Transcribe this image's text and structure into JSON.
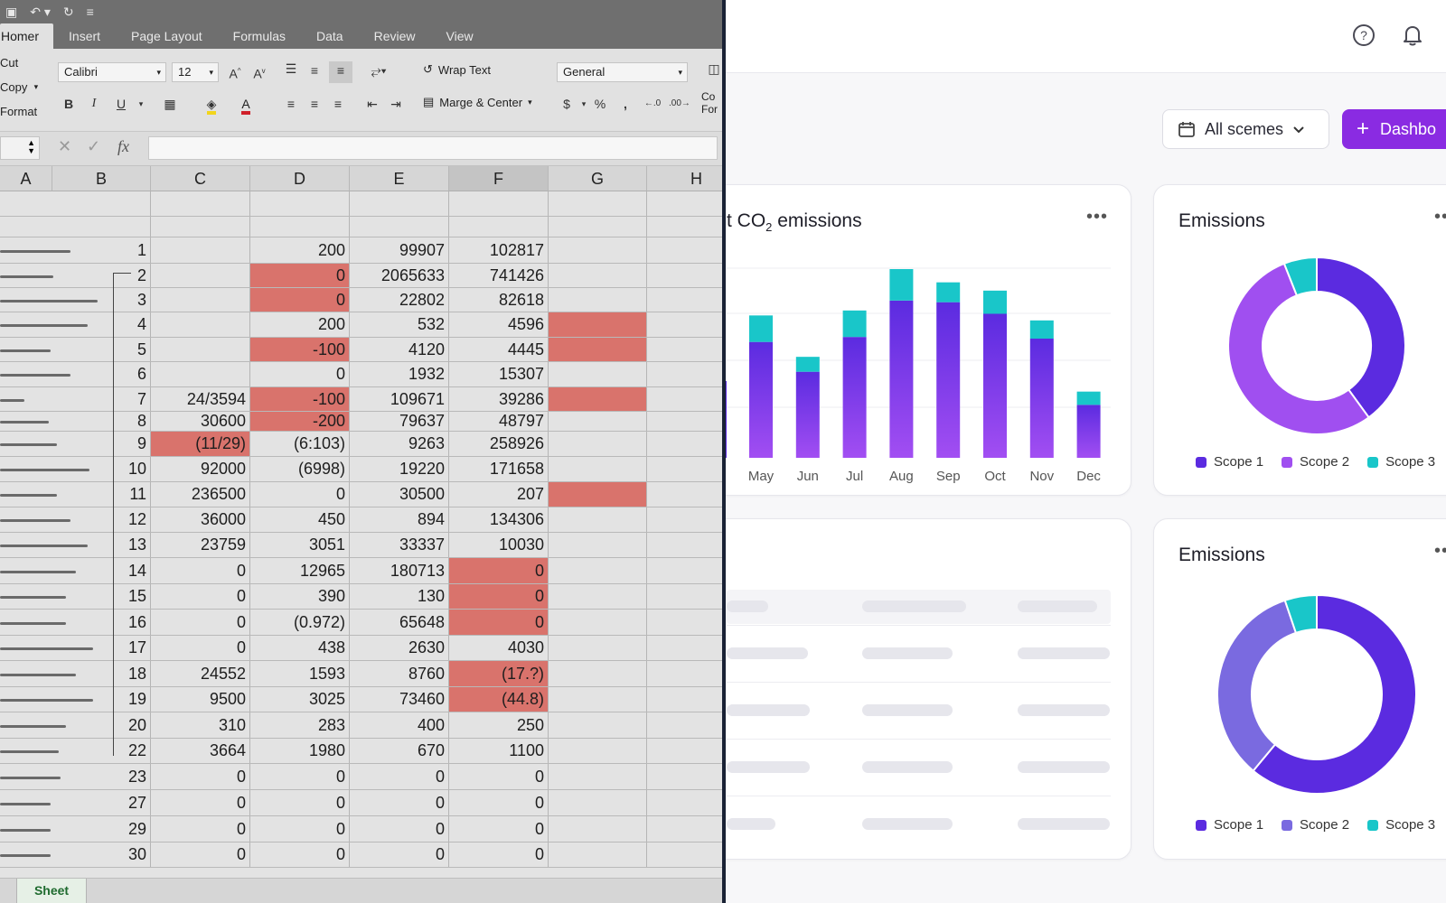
{
  "spreadsheet": {
    "tabs": [
      "Homer",
      "Insert",
      "Page Layout",
      "Formulas",
      "Data",
      "Review",
      "View"
    ],
    "clipboard": [
      "Cut",
      "Copy",
      "Format"
    ],
    "font_name": "Calibri",
    "font_size": "12",
    "wrap_text": "Wrap Text",
    "merge_center": "Marge & Center",
    "number_format": "General",
    "cond_format_fragment": [
      "Co",
      "For"
    ],
    "fx_label": "fx",
    "columns": [
      "A",
      "B",
      "C",
      "D",
      "E",
      "F",
      "G",
      "H"
    ],
    "rows": [
      {
        "b": "1",
        "c": "",
        "d": "200",
        "e": "99907",
        "f": "102817",
        "red": []
      },
      {
        "b": "2",
        "c": "",
        "d": "0",
        "e": "2065633",
        "f": "741426",
        "red": [
          "d"
        ]
      },
      {
        "b": "3",
        "c": "",
        "d": "0",
        "e": "22802",
        "f": "82618",
        "red": [
          "d"
        ]
      },
      {
        "b": "4",
        "c": "",
        "d": "200",
        "e": "532",
        "f": "4596",
        "red": [
          "g"
        ]
      },
      {
        "b": "5",
        "c": "",
        "d": "-100",
        "e": "4120",
        "f": "4445",
        "red": [
          "d",
          "g"
        ]
      },
      {
        "b": "6",
        "c": "",
        "d": "0",
        "e": "1932",
        "f": "15307",
        "red": []
      },
      {
        "b": "7",
        "c": "24/3594",
        "d": "-100",
        "e": "109671",
        "f": "39286",
        "red": [
          "d",
          "g"
        ]
      },
      {
        "b": "8",
        "c": "30600",
        "d": "-200",
        "e": "79637",
        "f": "48797",
        "red": [
          "d"
        ]
      },
      {
        "b": "9",
        "c": "(11/29)",
        "d": "(6:103)",
        "e": "9263",
        "f": "258926",
        "red": [
          "c"
        ]
      },
      {
        "b": "10",
        "c": "92000",
        "d": "(6998)",
        "e": "19220",
        "f": "171658",
        "red": []
      },
      {
        "b": "11",
        "c": "236500",
        "d": "0",
        "e": "30500",
        "f": "207",
        "red": [
          "g"
        ]
      },
      {
        "b": "12",
        "c": "36000",
        "d": "450",
        "e": "894",
        "f": "134306",
        "red": []
      },
      {
        "b": "13",
        "c": "23759",
        "d": "3051",
        "e": "33337",
        "f": "10030",
        "red": []
      },
      {
        "b": "14",
        "c": "0",
        "d": "12965",
        "e": "180713",
        "f": "0",
        "red": [
          "f"
        ]
      },
      {
        "b": "15",
        "c": "0",
        "d": "390",
        "e": "130",
        "f": "0",
        "red": [
          "f"
        ]
      },
      {
        "b": "16",
        "c": "0",
        "d": "(0.972)",
        "e": "65648",
        "f": "0",
        "red": [
          "f"
        ]
      },
      {
        "b": "17",
        "c": "0",
        "d": "438",
        "e": "2630",
        "f": "4030",
        "red": []
      },
      {
        "b": "18",
        "c": "24552",
        "d": "1593",
        "e": "8760",
        "f": "(17.?)",
        "red": [
          "f"
        ]
      },
      {
        "b": "19",
        "c": "9500",
        "d": "3025",
        "e": "73460",
        "f": "(44.8)",
        "red": [
          "f"
        ]
      },
      {
        "b": "20",
        "c": "310",
        "d": "283",
        "e": "400",
        "f": "250",
        "red": []
      },
      {
        "b": "22",
        "c": "3664",
        "d": "1980",
        "e": "670",
        "f": "1100",
        "red": []
      },
      {
        "b": "23",
        "c": "0",
        "d": "0",
        "e": "0",
        "f": "0",
        "red": []
      },
      {
        "b": "27",
        "c": "0",
        "d": "0",
        "e": "0",
        "f": "0",
        "red": []
      },
      {
        "b": "29",
        "c": "0",
        "d": "0",
        "e": "0",
        "f": "0",
        "red": []
      },
      {
        "b": "30",
        "c": "0",
        "d": "0",
        "e": "0",
        "f": "0",
        "red": []
      }
    ],
    "col_a_bars": [
      0.72,
      0.55,
      1.0,
      0.9,
      0.52,
      0.72,
      0.25,
      0.5,
      0.58,
      0.92,
      0.58,
      0.72,
      0.9,
      0.78,
      0.68,
      0.68,
      0.95,
      0.78,
      0.95,
      0.68,
      0.6,
      0.62,
      0.52,
      0.52,
      0.52
    ],
    "sheet_tab": "Sheet",
    "red_color": "#d9736c"
  },
  "dashboard": {
    "icons": [
      "help-circle-icon",
      "bell-icon",
      "calendar-icon",
      "chevron-down-icon",
      "plus-icon"
    ],
    "scene_filter": "All scemes",
    "dashboard_button": "Dashbo",
    "accent": "#8a2be2",
    "bar_card_title": "t CO",
    "bar_card_title_sub": "2",
    "bar_card_title_rest": " emissions",
    "pie_card_title": "Emissions",
    "pie2_card_title": "Emissions",
    "legend": [
      "Scope 1",
      "Scope 2",
      "Scope 3"
    ],
    "colors": {
      "scope1": "#5b2be0",
      "scope2": "#a04ff0",
      "scope2_alt": "#7a6ae0",
      "scope3": "#19c6c9"
    }
  },
  "chart_data": [
    {
      "type": "bar",
      "title": "t CO2 emissions",
      "categories": [
        "May",
        "Jun",
        "Jul",
        "Aug",
        "Sep",
        "Oct",
        "Nov",
        "Dec"
      ],
      "series": [
        {
          "values": [
            70,
            52,
            73,
            95,
            94,
            87,
            72,
            32
          ]
        },
        {
          "values": [
            16,
            9,
            16,
            19,
            12,
            14,
            11,
            8
          ]
        }
      ]
    },
    {
      "type": "pie",
      "title": "Emissions",
      "labels": [
        "Scope 1",
        "Scope 2",
        "Scope 3"
      ],
      "values": [
        40,
        54,
        6
      ]
    },
    {
      "type": "pie",
      "title": "Emissions",
      "labels": [
        "Scope 1",
        "Scope 2",
        "Scope 3"
      ],
      "values": [
        47,
        26,
        4
      ]
    }
  ]
}
